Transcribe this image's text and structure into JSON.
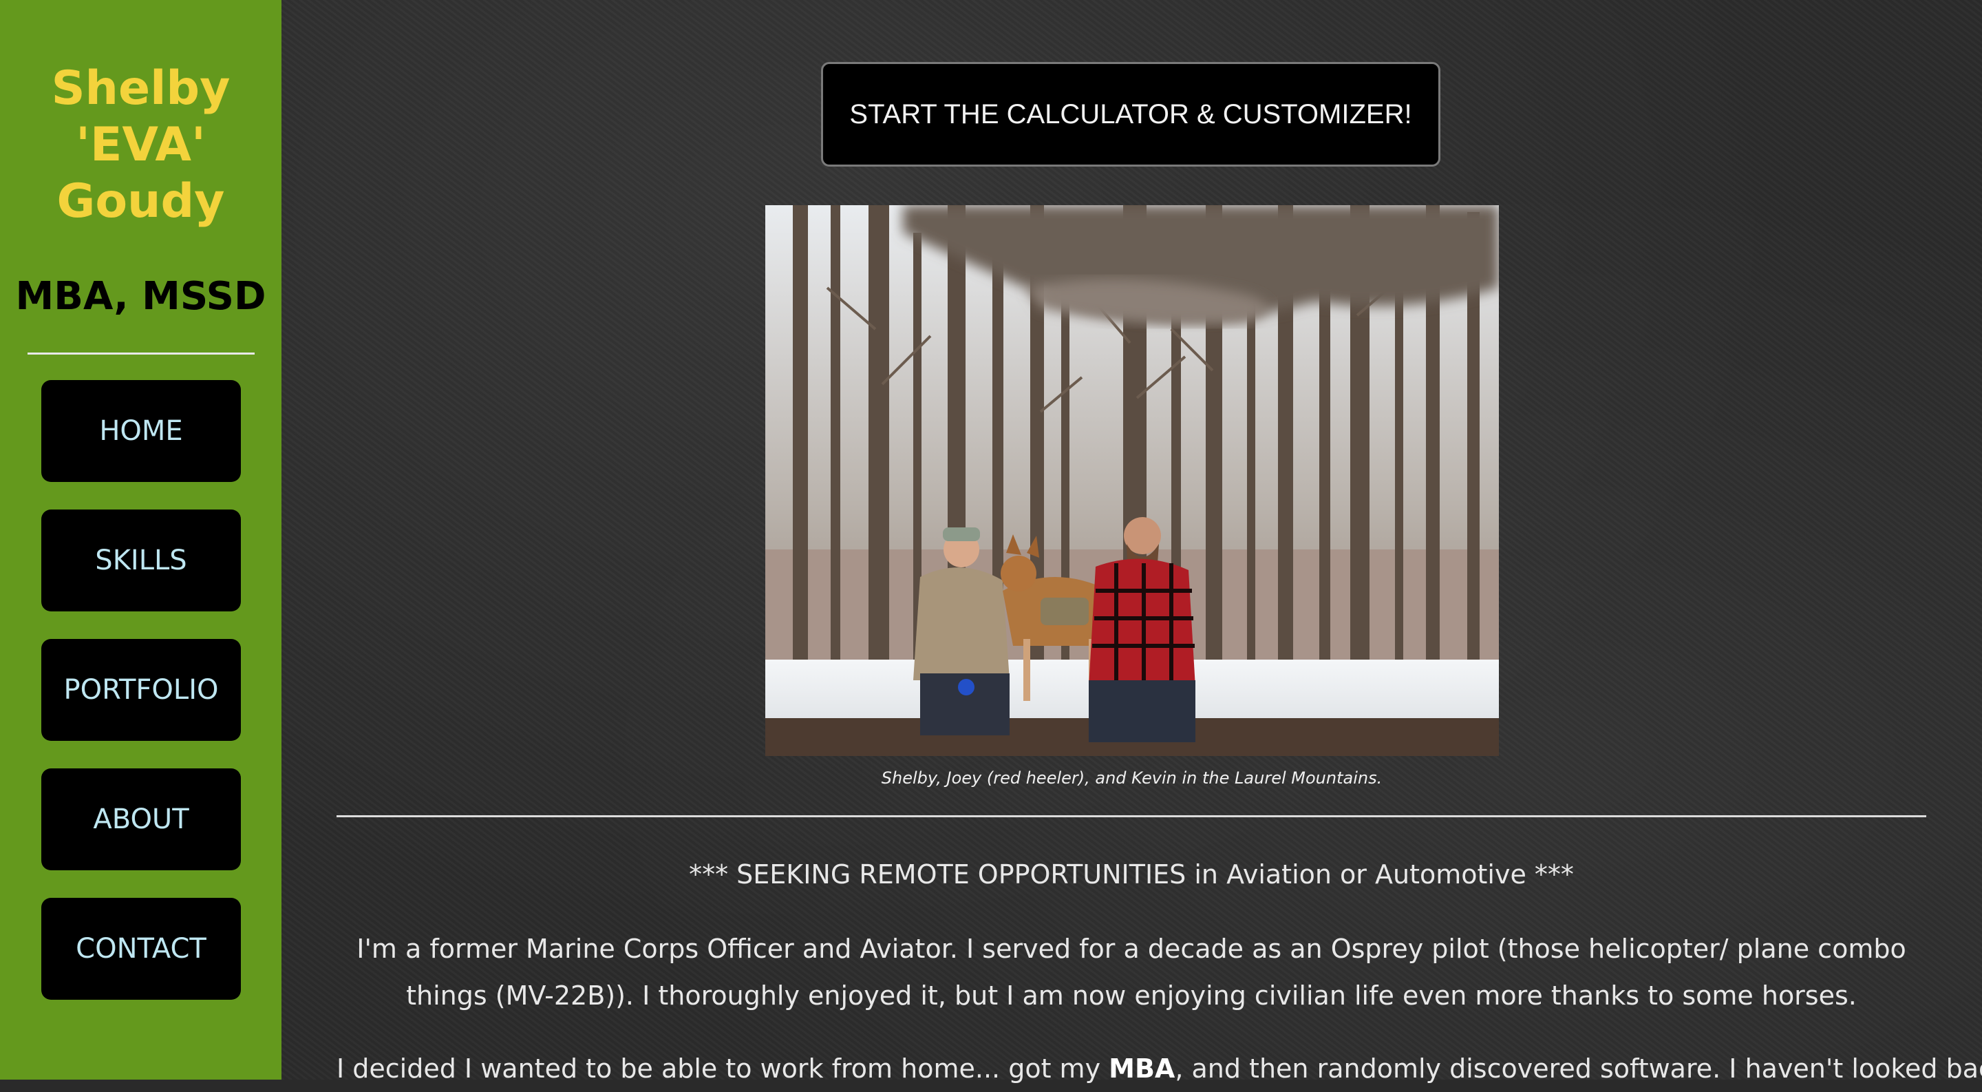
{
  "sidebar": {
    "name_lines": [
      "Shelby",
      "'EVA'",
      "Goudy"
    ],
    "credentials": "MBA, MSSD",
    "nav": [
      {
        "label": "HOME"
      },
      {
        "label": "SKILLS"
      },
      {
        "label": "PORTFOLIO"
      },
      {
        "label": "ABOUT"
      },
      {
        "label": "CONTACT"
      }
    ]
  },
  "main": {
    "cta_label": "START THE CALCULATOR & CUSTOMIZER!",
    "photo_caption": "Shelby, Joey (red heeler), and Kevin in the Laurel Mountains.",
    "seeking": "*** SEEKING REMOTE OPPORTUNITIES in Aviation or Automotive ***",
    "intro": "I'm a former Marine Corps Officer and Aviator. I served for a decade as an Osprey pilot (those helicopter/ plane combo things (MV-22B)). I thoroughly enjoyed it, but I am now enjoying civilian life even more thanks to some horses.",
    "decided_before": "I decided I wanted to be able to work from home... got my ",
    "decided_bold": "MBA",
    "decided_after": ", and then randomly discovered software. I haven't looked back"
  },
  "colors": {
    "sidebar_bg": "#64991d",
    "name_color": "#f3d33c",
    "nav_text": "#bfe7f2",
    "main_bg": "#2b2b2b"
  }
}
